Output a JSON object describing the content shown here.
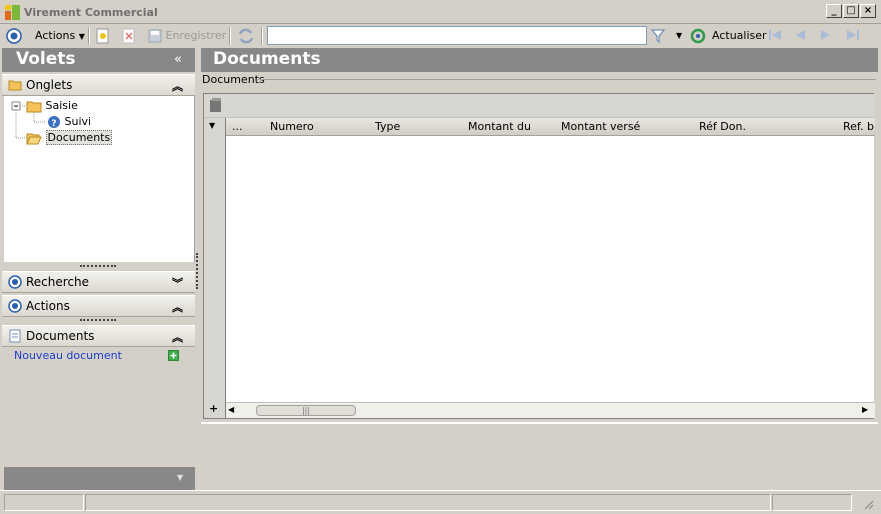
{
  "window": {
    "title": "Virement Commercial",
    "buttons": {
      "minimize": "_",
      "maximize": "□",
      "close": "×"
    }
  },
  "toolbar": {
    "actions_label": "Actions",
    "save_label": "Enregistrer",
    "search_placeholder": "",
    "refresh_label": "Actualiser"
  },
  "left": {
    "title": "Volets",
    "collapse_glyph": "«",
    "sections": {
      "onglets": "Onglets",
      "recherche": "Recherche",
      "actions": "Actions",
      "documents": "Documents"
    },
    "tree": {
      "root": "Saisie",
      "child": "Suivi",
      "sibling": "Documents"
    },
    "new_document": "Nouveau document"
  },
  "main": {
    "title": "Documents",
    "group_label": "Documents",
    "columns": [
      "...",
      "Numero",
      "Type",
      "Montant du",
      "Montant versé",
      "Réf Don.",
      "Ref. b"
    ],
    "scroll_grip": "|||"
  },
  "colors": {
    "panel_header": "#888888",
    "link": "#1a3fcf",
    "chrome": "#d4d0c8"
  }
}
